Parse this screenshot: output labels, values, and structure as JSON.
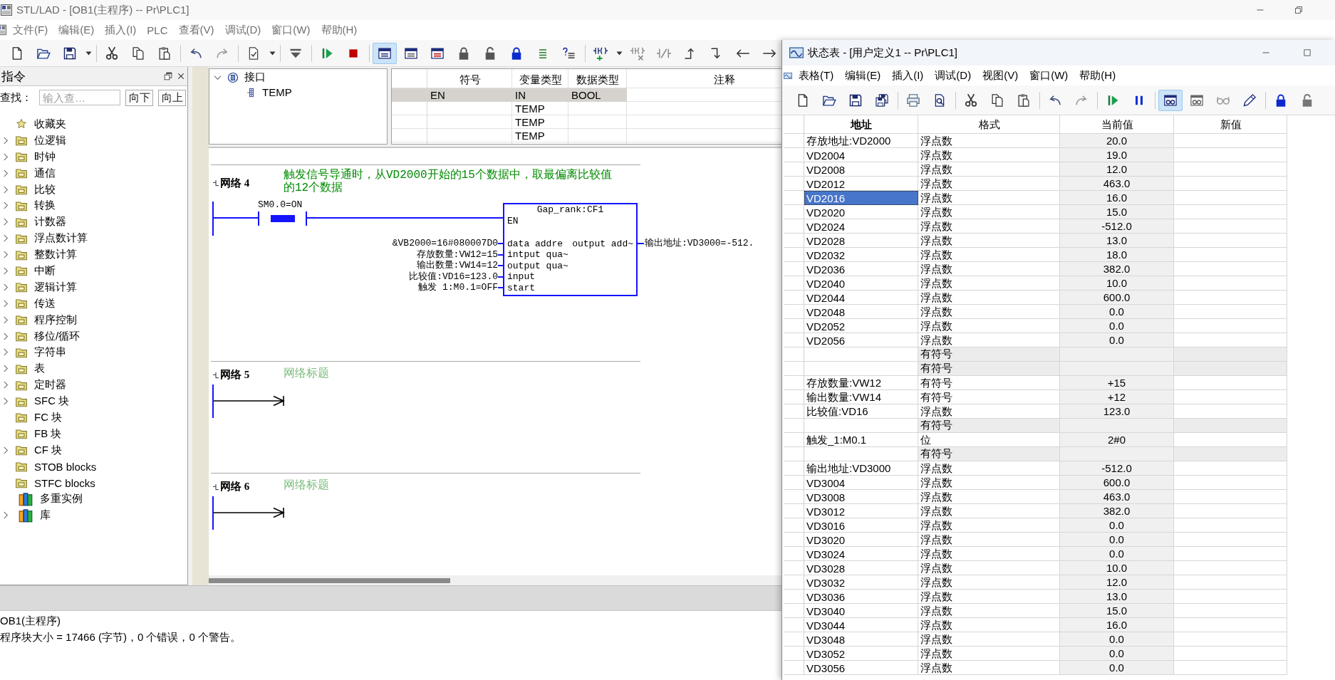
{
  "main_window": {
    "title": "STL/LAD - [OB1(主程序) -- Pr\\PLC1]",
    "menu": [
      "文件(F)",
      "编辑(E)",
      "插入(I)",
      "PLC",
      "查看(V)",
      "调试(D)",
      "窗口(W)",
      "帮助(H)"
    ],
    "toolbar": [
      [
        {
          "kind": "new",
          "selected": false
        },
        {
          "kind": "open",
          "selected": false
        },
        {
          "kind": "save",
          "selected": false
        },
        {
          "kind": "caret",
          "selected": false
        }
      ],
      [
        {
          "kind": "cut",
          "selected": false
        },
        {
          "kind": "copy",
          "selected": false
        },
        {
          "kind": "paste",
          "selected": false
        }
      ],
      [
        {
          "kind": "undo",
          "selected": false
        },
        {
          "kind": "redo",
          "selected": false
        }
      ],
      [
        {
          "kind": "check",
          "selected": false
        },
        {
          "kind": "caret",
          "selected": false
        }
      ],
      [
        {
          "kind": "compile",
          "selected": false
        }
      ],
      [
        {
          "kind": "run",
          "selected": false
        },
        {
          "kind": "stop",
          "selected": false
        }
      ],
      [
        {
          "kind": "win1",
          "selected": true
        },
        {
          "kind": "win2",
          "selected": false
        },
        {
          "kind": "win3",
          "selected": false
        },
        {
          "kind": "lock",
          "selected": false
        },
        {
          "kind": "unlock",
          "selected": false
        },
        {
          "kind": "lockblue",
          "selected": false
        },
        {
          "kind": "lines",
          "selected": false
        },
        {
          "kind": "qlines",
          "selected": false
        }
      ],
      [
        {
          "kind": "contact",
          "selected": false
        },
        {
          "kind": "caret",
          "selected": false
        },
        {
          "kind": "contactx",
          "selected": false
        },
        {
          "kind": "negate",
          "selected": false
        },
        {
          "kind": "up",
          "selected": false
        },
        {
          "kind": "down",
          "selected": false
        },
        {
          "kind": "left",
          "selected": false
        },
        {
          "kind": "right",
          "selected": false
        }
      ]
    ]
  },
  "instructions_panel": {
    "title": "指令",
    "search_label": "查找：",
    "search": {
      "placeholder": "输入查…"
    },
    "buttons": [
      "向下",
      "向上"
    ],
    "items": [
      {
        "label": "收藏夹",
        "kind": "favorites",
        "expandable": false
      },
      {
        "label": "位逻辑",
        "kind": "folder",
        "expandable": true,
        "expanded": false
      },
      {
        "label": "时钟",
        "kind": "folder",
        "expandable": true,
        "expanded": false
      },
      {
        "label": "通信",
        "kind": "folder",
        "expandable": true,
        "expanded": false
      },
      {
        "label": "比较",
        "kind": "folder",
        "expandable": true,
        "expanded": false
      },
      {
        "label": "转换",
        "kind": "folder",
        "expandable": true,
        "expanded": false
      },
      {
        "label": "计数器",
        "kind": "folder",
        "expandable": true,
        "expanded": false
      },
      {
        "label": "浮点数计算",
        "kind": "folder",
        "expandable": true,
        "expanded": false
      },
      {
        "label": "整数计算",
        "kind": "folder",
        "expandable": true,
        "expanded": false
      },
      {
        "label": "中断",
        "kind": "folder",
        "expandable": true,
        "expanded": false
      },
      {
        "label": "逻辑计算",
        "kind": "folder",
        "expandable": true,
        "expanded": false
      },
      {
        "label": "传送",
        "kind": "folder",
        "expandable": true,
        "expanded": false
      },
      {
        "label": "程序控制",
        "kind": "folder",
        "expandable": true,
        "expanded": false
      },
      {
        "label": "移位/循环",
        "kind": "folder",
        "expandable": true,
        "expanded": false
      },
      {
        "label": "字符串",
        "kind": "folder",
        "expandable": true,
        "expanded": false
      },
      {
        "label": "表",
        "kind": "folder",
        "expandable": true,
        "expanded": false
      },
      {
        "label": "定时器",
        "kind": "folder",
        "expandable": true,
        "expanded": false
      },
      {
        "label": "SFC 块",
        "kind": "folder",
        "expandable": true,
        "expanded": false
      },
      {
        "label": "FC 块",
        "kind": "folder",
        "expandable": false
      },
      {
        "label": "FB 块",
        "kind": "folder",
        "expandable": false
      },
      {
        "label": "CF 块",
        "kind": "folder",
        "expandable": true,
        "expanded": false
      },
      {
        "label": "STOB blocks",
        "kind": "folder",
        "expandable": false
      },
      {
        "label": "STFC blocks",
        "kind": "folder",
        "expandable": false
      },
      {
        "label": "多重实例",
        "kind": "library",
        "expandable": false
      },
      {
        "label": "库",
        "kind": "library",
        "expandable": true,
        "expanded": false
      }
    ]
  },
  "interface_tree": {
    "label": "接口",
    "expanded": true,
    "children": [
      {
        "label": "TEMP"
      }
    ]
  },
  "variable_table": {
    "columns": [
      "符号",
      "变量类型",
      "数据类型",
      "注释"
    ],
    "rows": [
      {
        "symbol": "EN",
        "var_type": "IN",
        "data_type": "BOOL",
        "read_only": true
      },
      {
        "var_type": "TEMP",
        "read_only": false
      },
      {
        "var_type": "TEMP",
        "read_only": false
      },
      {
        "var_type": "TEMP",
        "read_only": false
      }
    ]
  },
  "ladder": {
    "networks": [
      {
        "label": "网络 4",
        "kind": "rung",
        "title": "触发信号导通时，从VD2000开始的15个数据中，取最偏离比较值的12个数据",
        "contact": {
          "label": "SM0.0=ON",
          "on": true
        },
        "block": {
          "title": "Gap_rank:CF1",
          "enable": "EN",
          "inputs": [
            {
              "pin": "data addre",
              "operand": "&VB2000=16#080007D0"
            },
            {
              "pin": "intput qua~",
              "operand": "存放数量:VW12=15"
            },
            {
              "pin": "output qua~",
              "operand": "输出数量:VW14=12"
            },
            {
              "pin": "input",
              "operand": "比较值:VD16=123.0"
            },
            {
              "pin": "start",
              "operand": "触发 1:M0.1=OFF"
            }
          ],
          "outputs": [
            {
              "pin": "output add~",
              "operand": "输出地址:VD3000=-512."
            }
          ]
        }
      },
      {
        "label": "网络 5",
        "kind": "empty",
        "placeholder": "网络标题"
      },
      {
        "label": "网络 6",
        "kind": "empty",
        "placeholder": "网络标题"
      }
    ]
  },
  "output_pane": {
    "lines": [
      "OB1(主程序)",
      "程序块大小 = 17466 (字节)，0 个错误，0 个警告。"
    ]
  },
  "status_window": {
    "title": "状态表 - [用户定义1 -- Pr\\PLC1]",
    "menu": [
      "表格(T)",
      "编辑(E)",
      "插入(I)",
      "调试(D)",
      "视图(V)",
      "窗口(W)",
      "帮助(H)"
    ],
    "toolbar": [
      [
        {
          "kind": "new",
          "selected": false
        },
        {
          "kind": "open",
          "selected": false
        },
        {
          "kind": "save",
          "selected": false
        },
        {
          "kind": "saveall",
          "selected": false
        }
      ],
      [
        {
          "kind": "print",
          "selected": false
        },
        {
          "kind": "preview",
          "selected": false
        }
      ],
      [
        {
          "kind": "cut",
          "selected": false
        },
        {
          "kind": "copy",
          "selected": false
        },
        {
          "kind": "paste",
          "selected": false
        }
      ],
      [
        {
          "kind": "undo",
          "selected": false
        },
        {
          "kind": "redo",
          "selected": false
        }
      ],
      [
        {
          "kind": "run",
          "selected": false
        },
        {
          "kind": "pause",
          "selected": false
        }
      ],
      [
        {
          "kind": "glasswin",
          "selected": true
        },
        {
          "kind": "glasswin2",
          "selected": false
        },
        {
          "kind": "glasses",
          "selected": false
        },
        {
          "kind": "pencil",
          "selected": false
        }
      ],
      [
        {
          "kind": "lockblue",
          "selected": false
        },
        {
          "kind": "unlockgray",
          "selected": false
        }
      ]
    ],
    "table": {
      "columns": [
        "地址",
        "格式",
        "当前值",
        "新值"
      ],
      "rows": [
        {
          "address": "存放地址:VD2000",
          "format": "浮点数",
          "value": "20.0",
          "selected": false
        },
        {
          "address": "VD2004",
          "format": "浮点数",
          "value": "19.0",
          "selected": false
        },
        {
          "address": "VD2008",
          "format": "浮点数",
          "value": "12.0",
          "selected": false
        },
        {
          "address": "VD2012",
          "format": "浮点数",
          "value": "463.0",
          "selected": false
        },
        {
          "address": "VD2016",
          "format": "浮点数",
          "value": "16.0",
          "selected": true
        },
        {
          "address": "VD2020",
          "format": "浮点数",
          "value": "15.0",
          "selected": false
        },
        {
          "address": "VD2024",
          "format": "浮点数",
          "value": "-512.0",
          "selected": false
        },
        {
          "address": "VD2028",
          "format": "浮点数",
          "value": "13.0",
          "selected": false
        },
        {
          "address": "VD2032",
          "format": "浮点数",
          "value": "18.0",
          "selected": false
        },
        {
          "address": "VD2036",
          "format": "浮点数",
          "value": "382.0",
          "selected": false
        },
        {
          "address": "VD2040",
          "format": "浮点数",
          "value": "10.0",
          "selected": false
        },
        {
          "address": "VD2044",
          "format": "浮点数",
          "value": "600.0",
          "selected": false
        },
        {
          "address": "VD2048",
          "format": "浮点数",
          "value": "0.0",
          "selected": false
        },
        {
          "address": "VD2052",
          "format": "浮点数",
          "value": "0.0",
          "selected": false
        },
        {
          "address": "VD2056",
          "format": "浮点数",
          "value": "0.0",
          "selected": false
        },
        {
          "format": "有符号",
          "selected": false
        },
        {
          "format": "有符号",
          "selected": false
        },
        {
          "address": "存放数量:VW12",
          "format": "有符号",
          "value": "+15",
          "selected": false
        },
        {
          "address": "输出数量:VW14",
          "format": "有符号",
          "value": "+12",
          "selected": false
        },
        {
          "address": "比较值:VD16",
          "format": "浮点数",
          "value": "123.0",
          "selected": false
        },
        {
          "format": "有符号",
          "selected": false
        },
        {
          "address": "触发_1:M0.1",
          "format": "位",
          "value": "2#0",
          "selected": false
        },
        {
          "format": "有符号",
          "selected": false
        },
        {
          "address": "输出地址:VD3000",
          "format": "浮点数",
          "value": "-512.0",
          "selected": false
        },
        {
          "address": "VD3004",
          "format": "浮点数",
          "value": "600.0",
          "selected": false
        },
        {
          "address": "VD3008",
          "format": "浮点数",
          "value": "463.0",
          "selected": false
        },
        {
          "address": "VD3012",
          "format": "浮点数",
          "value": "382.0",
          "selected": false
        },
        {
          "address": "VD3016",
          "format": "浮点数",
          "value": "0.0",
          "selected": false
        },
        {
          "address": "VD3020",
          "format": "浮点数",
          "value": "0.0",
          "selected": false
        },
        {
          "address": "VD3024",
          "format": "浮点数",
          "value": "0.0",
          "selected": false
        },
        {
          "address": "VD3028",
          "format": "浮点数",
          "value": "10.0",
          "selected": false
        },
        {
          "address": "VD3032",
          "format": "浮点数",
          "value": "12.0",
          "selected": false
        },
        {
          "address": "VD3036",
          "format": "浮点数",
          "value": "13.0",
          "selected": false
        },
        {
          "address": "VD3040",
          "format": "浮点数",
          "value": "15.0",
          "selected": false
        },
        {
          "address": "VD3044",
          "format": "浮点数",
          "value": "16.0",
          "selected": false
        },
        {
          "address": "VD3048",
          "format": "浮点数",
          "value": "0.0",
          "selected": false
        },
        {
          "address": "VD3052",
          "format": "浮点数",
          "value": "0.0",
          "selected": false
        },
        {
          "address": "VD3056",
          "format": "浮点数",
          "value": "0.0",
          "selected": false
        }
      ]
    }
  }
}
